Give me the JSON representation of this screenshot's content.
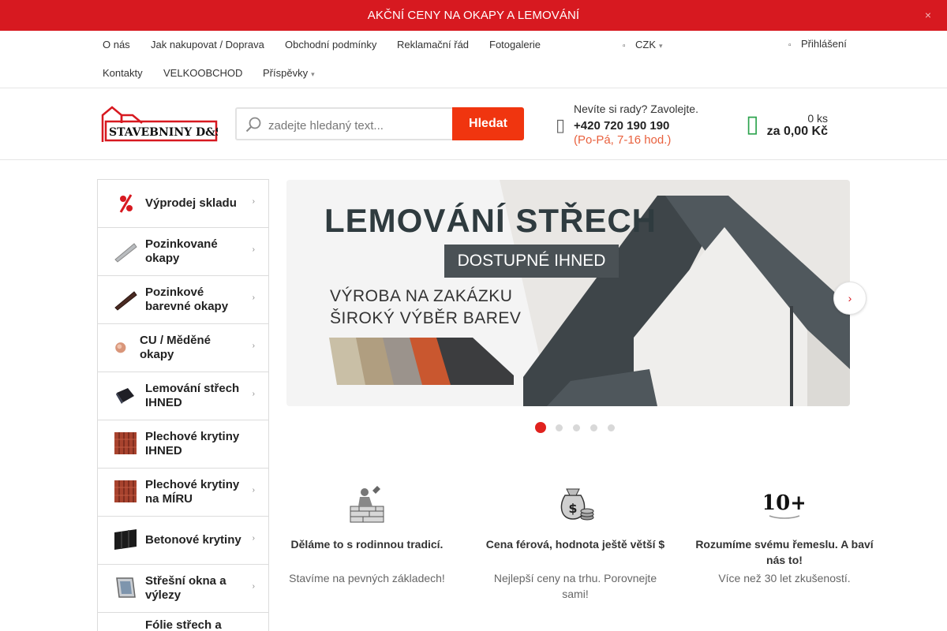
{
  "promo": {
    "text": "AKČNÍ CENY NA OKAPY A LEMOVÁNÍ",
    "close_glyph": "×"
  },
  "nav": {
    "row1": [
      "O nás",
      "Jak nakupovat / Doprava",
      "Obchodní podmínky",
      "Reklamační řád",
      "Fotogalerie"
    ],
    "row2": [
      "Kontakty",
      "VELKOOBCHOD",
      "Příspěvky"
    ],
    "currency": "CZK",
    "login": "Přihlášení"
  },
  "header": {
    "logo_text": "STAVEBNINY D&S",
    "search_placeholder": "zadejte hledaný text...",
    "search_button": "Hledat",
    "help_question": "Nevíte si rady? Zavolejte.",
    "help_phone": "+420 720 190 190",
    "help_hours": "(Po-Pá, 7-16 hod.)",
    "cart_qty": "0 ks",
    "cart_total": "za 0,00 Kč"
  },
  "sidebar": {
    "categories": [
      {
        "label": "Výprodej skladu",
        "icon": "sale-percent-icon",
        "has_children": true
      },
      {
        "label": "Pozinkované okapy",
        "icon": "zinc-gutter-icon",
        "has_children": true
      },
      {
        "label": "Pozinkové barevné okapy",
        "icon": "color-gutter-icon",
        "has_children": true
      },
      {
        "label": "CU / Měděné okapy",
        "icon": "copper-gutter-icon",
        "has_children": true
      },
      {
        "label": "Lemování střech IHNED",
        "icon": "roof-flashing-icon",
        "has_children": true
      },
      {
        "label": "Plechové krytiny IHNED",
        "icon": "metal-roofing-icon",
        "has_children": false
      },
      {
        "label": "Plechové krytiny na MÍRU",
        "icon": "metal-roofing-custom-icon",
        "has_children": true
      },
      {
        "label": "Betonové krytiny",
        "icon": "concrete-tile-icon",
        "has_children": true
      },
      {
        "label": "Střešní okna a výlezy",
        "icon": "roof-window-icon",
        "has_children": true
      },
      {
        "label": "Fólie střech a",
        "icon": "roof-foil-icon",
        "has_children": true
      }
    ]
  },
  "banner": {
    "title": "LEMOVÁNÍ STŘECH",
    "chip": "DOSTUPNÉ IHNED",
    "line1": "VÝROBA NA ZAKÁZKU",
    "line2": "ŠIROKÝ VÝBĚR BAREV",
    "slide_count": 5,
    "active_slide": 1
  },
  "features": [
    {
      "title": "Děláme to s rodinnou tradicí.",
      "sub": "Stavíme na pevných základech!",
      "icon": "family-tradition-icon"
    },
    {
      "title": "Cena férová, hodnota ještě větší $",
      "sub": "Nejlepší ceny na trhu. Porovnejte sami!",
      "icon": "money-bag-icon"
    },
    {
      "title": "Rozumíme svému řemeslu. A baví nás to!",
      "sub": "Více než 30 let zkušeností.",
      "icon": "ten-plus-years-icon"
    }
  ],
  "colors": {
    "brand_red": "#d71920",
    "search_button": "#f0350f",
    "cart_green": "#2ea44f",
    "hours_orange": "#e9613e"
  }
}
